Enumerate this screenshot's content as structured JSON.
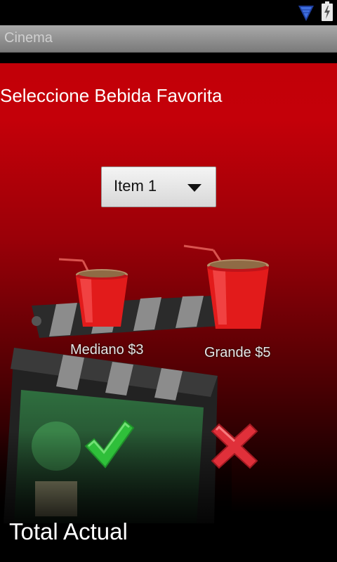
{
  "app": {
    "title": "Cinema"
  },
  "status_bar": {
    "icons": [
      "signal-icon",
      "battery-charging-icon"
    ]
  },
  "main": {
    "prompt": "Seleccione Bebida Favorita",
    "dropdown": {
      "selected": "Item 1"
    },
    "options": [
      {
        "label": "Mediano $3",
        "icon": "medium-drink-cup-icon"
      },
      {
        "label": "Grande $5",
        "icon": "large-drink-cup-icon"
      }
    ],
    "actions": {
      "confirm_icon": "checkmark-icon",
      "cancel_icon": "cross-icon"
    },
    "total_label": "Total Actual"
  },
  "colors": {
    "background_red": "#c20008",
    "title_bar": "#8f8f8f",
    "confirm": "#3fcf3f",
    "cancel": "#e0303a"
  }
}
